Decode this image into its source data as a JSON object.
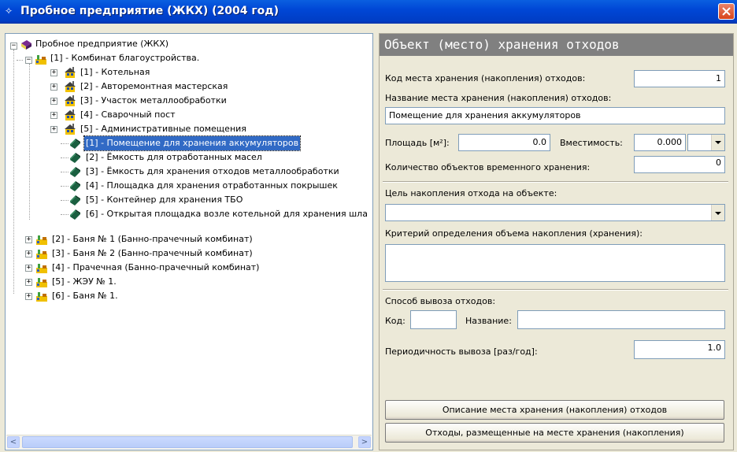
{
  "window": {
    "title": "Пробное предприятие (ЖКХ)  (2004 год)"
  },
  "tree": {
    "root": "Пробное предприятие (ЖКХ)",
    "combinat": "[1] - Комбинат благоустройства.",
    "buildings": [
      "[1] - Котельная",
      "[2] - Авторемонтная мастерская",
      "[3] - Участок металлообработки",
      "[4] - Сварочный пост",
      "[5] - Административные помещения"
    ],
    "storage": [
      "[1] - Помещение для хранения аккумуляторов",
      "[2] - Ёмкость для отработанных масел",
      "[3] - Ёмкость для хранения отходов металлообработки",
      "[4] - Площадка для хранения отработанных покрышек",
      "[5] - Контейнер для хранения ТБО",
      "[6] - Открытая площадка возле котельной для хранения шла"
    ],
    "others": [
      "[2] - Баня № 1 (Банно-прачечный комбинат)",
      "[3] - Баня № 2 (Банно-прачечный комбинат)",
      "[4] - Прачечная (Банно-прачечный комбинат)",
      "[5] - ЖЭУ № 1.",
      "[6] - Баня № 1."
    ],
    "selected_index": 0
  },
  "form": {
    "header": "Объект (место) хранения отходов",
    "code_label": "Код места хранения (накопления) отходов:",
    "code_value": "1",
    "name_label": "Название места хранения (накопления) отходов:",
    "name_value": "Помещение для хранения аккумуляторов",
    "area_label": "Площадь [м²]:",
    "area_value": "0.0",
    "capacity_label": "Вместимость:",
    "capacity_value": "0.000",
    "capacity_unit": "",
    "count_label": "Количество объектов временного хранения:",
    "count_value": "0",
    "purpose_label": "Цель накопления отхода на объекте:",
    "purpose_value": "",
    "criterion_label": "Критерий определения объема накопления (хранения):",
    "criterion_value": "",
    "removal_label": "Способ вывоза отходов:",
    "removal_code_label": "Код:",
    "removal_code_value": "",
    "removal_name_label": "Название:",
    "removal_name_value": "",
    "period_label": "Периодичность вывоза [раз/год]:",
    "period_value": "1.0",
    "btn_description": "Описание места хранения (накопления) отходов",
    "btn_wastes": "Отходы, размещенные на месте хранения (накопления)"
  },
  "colors": {
    "titlebar": "#0047d6",
    "selection": "#316ac5",
    "panel_header": "#808080"
  }
}
